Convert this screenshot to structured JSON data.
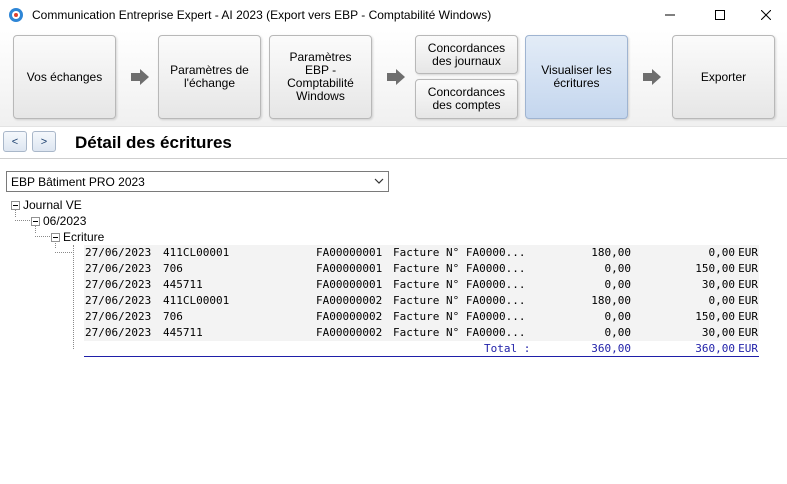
{
  "window": {
    "title": "Communication Entreprise Expert - AI 2023 (Export vers EBP - Comptabilité Windows)"
  },
  "wizard": {
    "steps": [
      {
        "label": "Vos échanges"
      },
      {
        "label": "Paramètres de l'échange"
      },
      {
        "label": "Paramètres EBP - Comptabilité Windows"
      },
      {
        "label": "Concordances des journaux"
      },
      {
        "label": "Concordances des comptes"
      },
      {
        "label": "Visualiser les écritures"
      },
      {
        "label": "Exporter"
      }
    ]
  },
  "header": {
    "prev_label": "<",
    "next_label": ">",
    "title": "Détail des écritures"
  },
  "company_select": {
    "value": "EBP Bâtiment PRO 2023"
  },
  "tree": {
    "journal": "Journal VE",
    "period": "06/2023",
    "section": "Ecriture"
  },
  "entries": [
    {
      "date": "27/06/2023",
      "account": "411CL00001",
      "piece": "FA00000001",
      "label": "Facture N° FA0000...",
      "debit": "180,00",
      "credit": "0,00",
      "currency": "EUR"
    },
    {
      "date": "27/06/2023",
      "account": "706",
      "piece": "FA00000001",
      "label": "Facture N° FA0000...",
      "debit": "0,00",
      "credit": "150,00",
      "currency": "EUR"
    },
    {
      "date": "27/06/2023",
      "account": "445711",
      "piece": "FA00000001",
      "label": "Facture N° FA0000...",
      "debit": "0,00",
      "credit": "30,00",
      "currency": "EUR"
    },
    {
      "date": "27/06/2023",
      "account": "411CL00001",
      "piece": "FA00000002",
      "label": "Facture N° FA0000...",
      "debit": "180,00",
      "credit": "0,00",
      "currency": "EUR"
    },
    {
      "date": "27/06/2023",
      "account": "706",
      "piece": "FA00000002",
      "label": "Facture N° FA0000...",
      "debit": "0,00",
      "credit": "150,00",
      "currency": "EUR"
    },
    {
      "date": "27/06/2023",
      "account": "445711",
      "piece": "FA00000002",
      "label": "Facture N° FA0000...",
      "debit": "0,00",
      "credit": "30,00",
      "currency": "EUR"
    }
  ],
  "total": {
    "label": "Total :",
    "debit": "360,00",
    "credit": "360,00",
    "currency": "EUR"
  }
}
